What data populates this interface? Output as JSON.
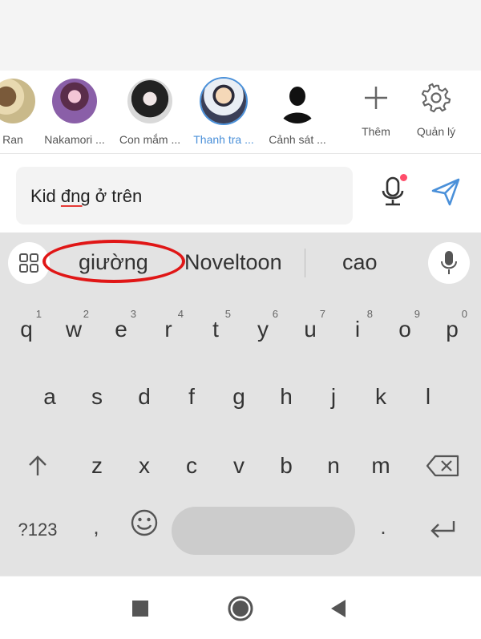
{
  "characters": [
    {
      "name": "Ran"
    },
    {
      "name": "Nakamori ..."
    },
    {
      "name": "Con mắm ..."
    },
    {
      "name": "Thanh tra ...",
      "selected": true
    },
    {
      "name": "Cảnh sát ..."
    }
  ],
  "actions": {
    "add_label": "Thêm",
    "manage_label": "Quản lý"
  },
  "input": {
    "text_before": "Kid ",
    "text_typo": "đng",
    "text_after": " ở trên"
  },
  "suggestions": [
    "giường",
    "Noveltoon",
    "cao"
  ],
  "keyboard": {
    "row1": [
      {
        "k": "q",
        "n": "1"
      },
      {
        "k": "w",
        "n": "2"
      },
      {
        "k": "e",
        "n": "3"
      },
      {
        "k": "r",
        "n": "4"
      },
      {
        "k": "t",
        "n": "5"
      },
      {
        "k": "y",
        "n": "6"
      },
      {
        "k": "u",
        "n": "7"
      },
      {
        "k": "i",
        "n": "8"
      },
      {
        "k": "o",
        "n": "9"
      },
      {
        "k": "p",
        "n": "0"
      }
    ],
    "row2": [
      "a",
      "s",
      "d",
      "f",
      "g",
      "h",
      "j",
      "k",
      "l"
    ],
    "row3": [
      "z",
      "x",
      "c",
      "v",
      "b",
      "n",
      "m"
    ],
    "symbols_label": "?123",
    "comma": ",",
    "period": "."
  },
  "colors": {
    "accent": "#4a90d9",
    "highlight_ring": "#e01616",
    "notification_dot": "#ff4d6a",
    "keyboard_bg": "#e3e3e3"
  }
}
